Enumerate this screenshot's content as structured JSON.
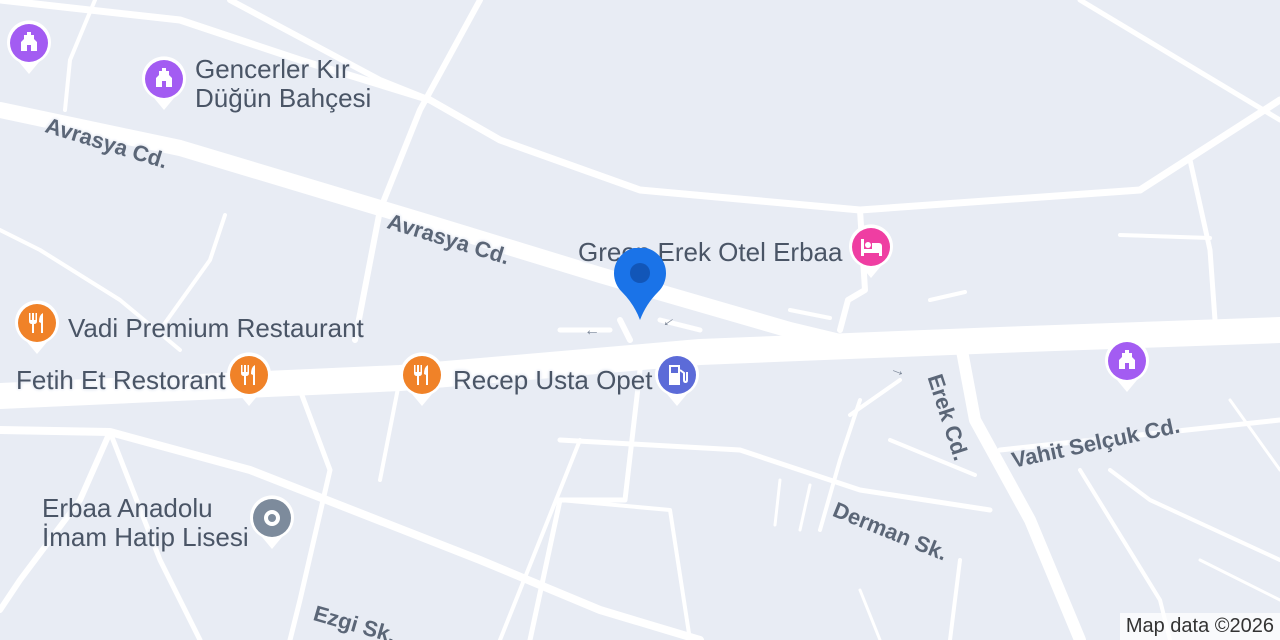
{
  "streets": {
    "avrasya_1": "Avrasya Cd.",
    "avrasya_2": "Avrasya Cd.",
    "erek": "Erek Cd.",
    "vahit": "Vahit Selçuk Cd.",
    "derman": "Derman Sk.",
    "ezgi": "Ezgi Sk."
  },
  "pois": {
    "gencerler_line1": "Gencerler Kır",
    "gencerler_line2": "Düğün Bahçesi",
    "green_erek": "Green Erek Otel Erbaa",
    "vadi": "Vadi Premium Restaurant",
    "fetih": "Fetih Et Restorant",
    "recep": "Recep Usta Opet",
    "lisesi_line1": "Erbaa Anadolu",
    "lisesi_line2": "İmam Hatip Lisesi"
  },
  "icons": {
    "venue": "wedding-hall-icon",
    "hotel": "bed-icon",
    "restaurant": "fork-knife-icon",
    "gas": "gas-station-icon",
    "school": "school-icon",
    "marker": "location-marker-icon"
  },
  "colors": {
    "background": "#e8ecf4",
    "road": "#ffffff",
    "venue_pin": "#a35cf2",
    "hotel_pin": "#ef3ea2",
    "restaurant_pin": "#f08228",
    "gas_pin": "#5c6bd8",
    "school_pin": "#7d8b9c",
    "marker": "#1a73e8"
  },
  "attribution": "Map data ©2026"
}
